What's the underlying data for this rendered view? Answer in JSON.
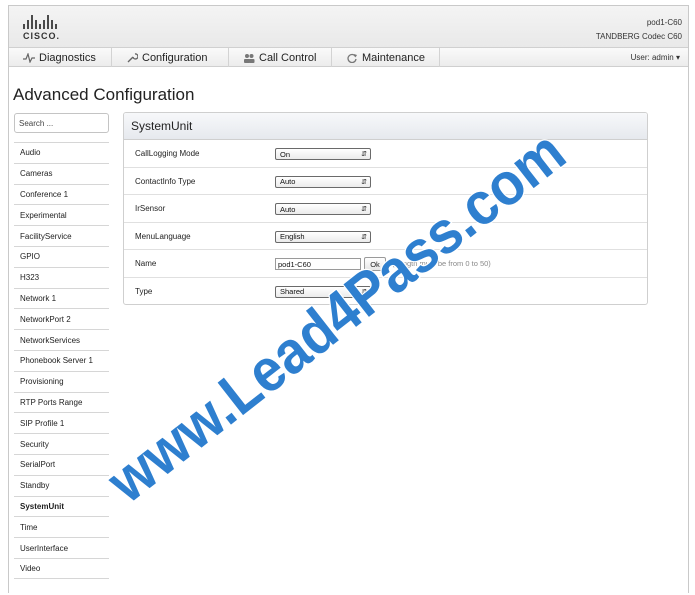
{
  "device": {
    "name": "pod1-C60",
    "model": "TANDBERG Codec C60"
  },
  "brand": {
    "logo_text": "CISCO."
  },
  "nav": {
    "items": [
      {
        "label": "Diagnostics",
        "icon": "pulse-icon"
      },
      {
        "label": "Configuration",
        "icon": "wrench-icon"
      },
      {
        "label": "Call Control",
        "icon": "people-icon"
      },
      {
        "label": "Maintenance",
        "icon": "refresh-icon"
      }
    ],
    "user_label": "User: admin ▾"
  },
  "page": {
    "title": "Advanced Configuration"
  },
  "search": {
    "placeholder": "Search ..."
  },
  "sidebar": {
    "items": [
      "Audio",
      "Cameras",
      "Conference 1",
      "Experimental",
      "FacilityService",
      "GPIO",
      "H323",
      "Network 1",
      "NetworkPort 2",
      "NetworkServices",
      "Phonebook Server 1",
      "Provisioning",
      "RTP Ports Range",
      "SIP Profile 1",
      "Security",
      "SerialPort",
      "Standby",
      "SystemUnit",
      "Time",
      "UserInterface",
      "Video"
    ],
    "active": "SystemUnit"
  },
  "panel": {
    "title": "SystemUnit",
    "rows": [
      {
        "label": "CallLogging Mode",
        "value": "On"
      },
      {
        "label": "ContactInfo Type",
        "value": "Auto"
      },
      {
        "label": "IrSensor",
        "value": "Auto"
      },
      {
        "label": "MenuLanguage",
        "value": "English"
      },
      {
        "label": "Name",
        "value": "pod1-C60",
        "button": "Ok",
        "hint": "(Length must be from 0 to 50)"
      },
      {
        "label": "Type",
        "value": "Shared"
      }
    ]
  },
  "watermark": {
    "text": "www.Lead4Pass.com",
    "color": "#2e7fcf"
  },
  "colors": {
    "header_bg": "#ececec",
    "panel_head_bg": "#e9ecf0",
    "border": "#cfcfcf"
  }
}
